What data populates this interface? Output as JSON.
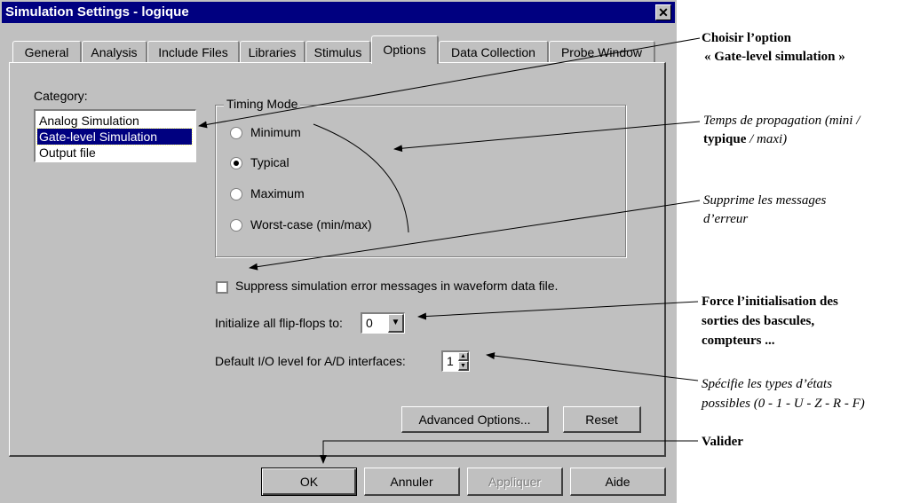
{
  "window": {
    "title": "Simulation Settings - logique",
    "close_glyph": "✕"
  },
  "tabs": [
    {
      "label": "General"
    },
    {
      "label": "Analysis"
    },
    {
      "label": "Include Files"
    },
    {
      "label": "Libraries"
    },
    {
      "label": "Stimulus"
    },
    {
      "label": "Options",
      "active": true
    },
    {
      "label": "Data Collection"
    },
    {
      "label": "Probe Window"
    }
  ],
  "category": {
    "label": "Category:",
    "items": [
      "Analog Simulation",
      "Gate-level Simulation",
      "Output file"
    ],
    "selected": "Gate-level Simulation"
  },
  "timing_mode": {
    "label": "Timing Mode",
    "options": [
      "Minimum",
      "Typical",
      "Maximum",
      "Worst-case (min/max)"
    ],
    "selected": "Typical"
  },
  "suppress": {
    "label": "Suppress simulation error messages in waveform data file.",
    "checked": false
  },
  "init_flipflops": {
    "label": "Initialize all flip-flops to:",
    "value": "0",
    "arrow": "▼"
  },
  "io_level": {
    "label": "Default I/O level for A/D interfaces:",
    "value": "1",
    "up": "▲",
    "down": "▼"
  },
  "buttons": {
    "advanced": "Advanced Options...",
    "reset": "Reset",
    "ok": "OK",
    "cancel": "Annuler",
    "apply": "Appliquer",
    "help": "Aide"
  },
  "annotations": {
    "gate_level_1": "Choisir l’option",
    "gate_level_2": "« Gate-level simulation »",
    "timing_1": "Temps de propagation (mini /",
    "timing_2a": "typique",
    "timing_2b": " / maxi)",
    "suppress_1": "Supprime les messages",
    "suppress_2": "d’erreur",
    "init_1": "Force l’initialisation des",
    "init_2": "sorties des bascules,",
    "init_3": "compteurs ...",
    "io_1": "Spécifie les types d’états",
    "io_2": "possibles (0 - 1 - U - Z - R - F)",
    "validate": "Valider"
  },
  "colors": {
    "face": "#c0c0c0",
    "titlebar": "#000080",
    "selection": "#000080"
  }
}
